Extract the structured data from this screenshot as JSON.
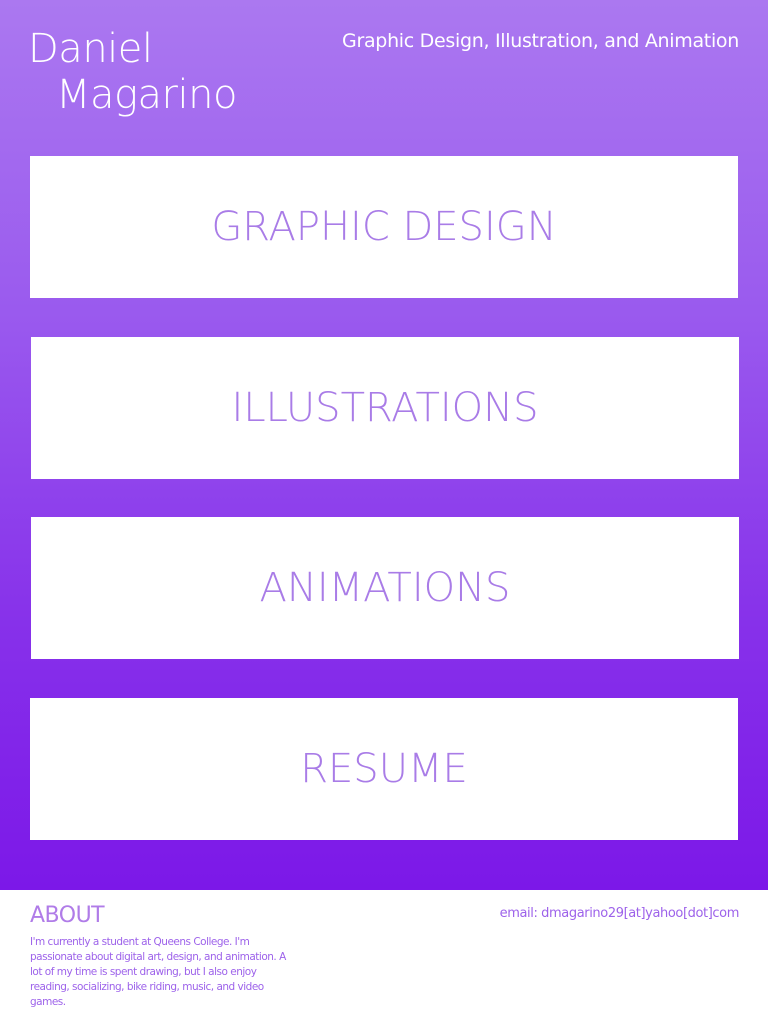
{
  "header": {
    "name_line1": "Daniel",
    "name_line2": "Magarino",
    "tagline": "Graphic Design, Illustration, and Animation"
  },
  "nav": {
    "items": [
      {
        "label": "GRAPHIC DESIGN"
      },
      {
        "label": "ILLUSTRATIONS"
      },
      {
        "label": "ANIMATIONS"
      },
      {
        "label": "RESUME"
      }
    ]
  },
  "footer": {
    "about_heading": "ABOUT",
    "about_text": "I'm currently a student at Queens College. I'm passionate about digital art, design, and animation. A lot of my time is spent drawing, but I also enjoy reading, socializing, bike riding, music, and video games.",
    "email": "email: dmagarino29[at]yahoo[dot]com"
  },
  "colors": {
    "gradient_top": "#ab78f0",
    "gradient_bottom": "#7c18e8",
    "tile_text": "#a97ce7",
    "footer_text": "#9d62ea"
  }
}
